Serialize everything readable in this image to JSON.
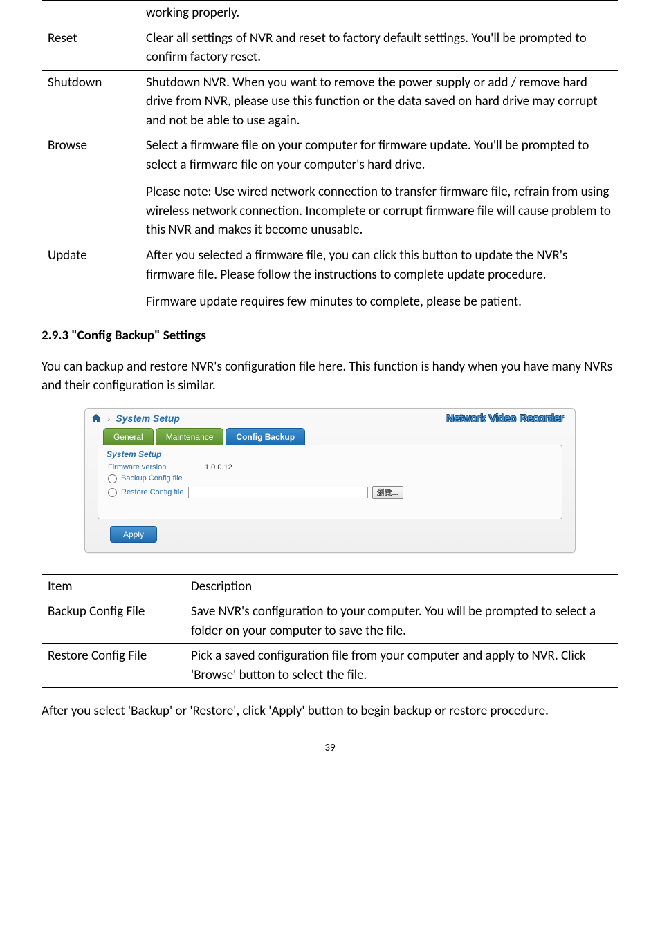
{
  "table1": {
    "rows": [
      {
        "key": "",
        "desc": "working properly."
      },
      {
        "key": "Reset",
        "desc": "Clear all settings of NVR and reset to factory default settings. You'll be prompted to confirm factory reset."
      },
      {
        "key": "Shutdown",
        "desc": "Shutdown NVR. When you want to remove the power supply or add / remove hard drive from NVR, please use this function or the data saved on hard drive may corrupt and not be able to use again."
      },
      {
        "key": "Browse",
        "desc_p1": "Select a firmware file on your computer for firmware update. You'll be prompted to select a firmware file on your computer's hard drive.",
        "desc_p2": "Please note: Use wired network connection to transfer firmware file, refrain from using wireless network connection. Incomplete or corrupt firmware file will cause problem to this NVR and makes it become unusable."
      },
      {
        "key": "Update",
        "desc_p1": "After you selected a firmware file, you can click this button to update the NVR's firmware file. Please follow the instructions to complete update procedure.",
        "desc_p2": "Firmware update requires few minutes to complete, please be patient."
      }
    ]
  },
  "heading": "2.9.3 \"Config Backup\" Settings",
  "intro": "You can backup and restore NVR's configuration file here. This function is handy when you have many NVRs and their configuration is similar.",
  "shot": {
    "breadcrumb_title": "System Setup",
    "brand": "Network Video Recorder",
    "tabs": {
      "general": "General",
      "maintenance": "Maintenance",
      "config_backup": "Config Backup"
    },
    "fieldset": "System Setup",
    "firmware_label": "Firmware version",
    "firmware_value": "1.0.0.12",
    "backup_label": "Backup Config file",
    "restore_label": "Restore Config file",
    "browse_btn": "瀏覽...",
    "apply": "Apply"
  },
  "table2": {
    "header": {
      "item": "Item",
      "desc": "Description"
    },
    "rows": [
      {
        "key": "Backup Config File",
        "desc": "Save NVR's configuration to your computer. You will be prompted to select a folder on your computer to save the file."
      },
      {
        "key": "Restore Config File",
        "desc": "Pick a saved configuration file from your computer and apply to NVR. Click 'Browse' button to select the file."
      }
    ]
  },
  "footer_text": "After you select 'Backup' or 'Restore', click 'Apply' button to begin backup or restore procedure.",
  "page_number": "39"
}
